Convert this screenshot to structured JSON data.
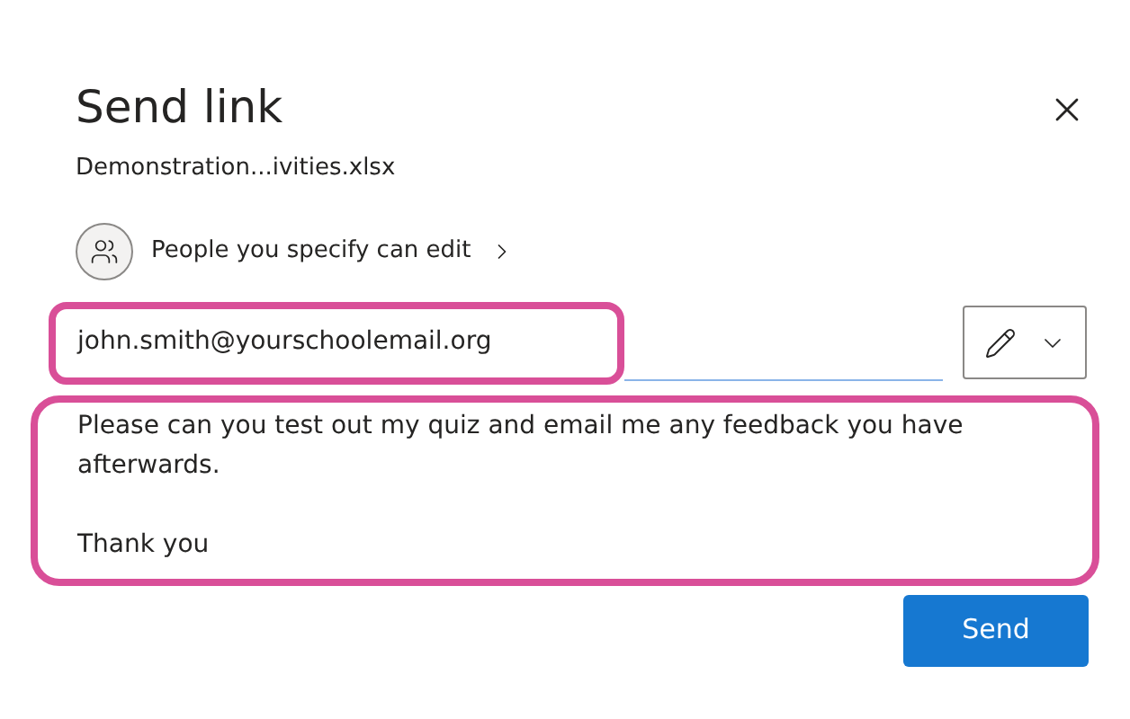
{
  "dialog": {
    "title": "Send link",
    "file_name": "Demonstration...ivities.xlsx",
    "permission": "People you specify can edit",
    "recipient": "john.smith@yourschoolemail.org",
    "message_lines": [
      "Please can you test out my quiz and email me any feedback you have afterwards.",
      "Thank you"
    ],
    "send_button": "Send"
  }
}
